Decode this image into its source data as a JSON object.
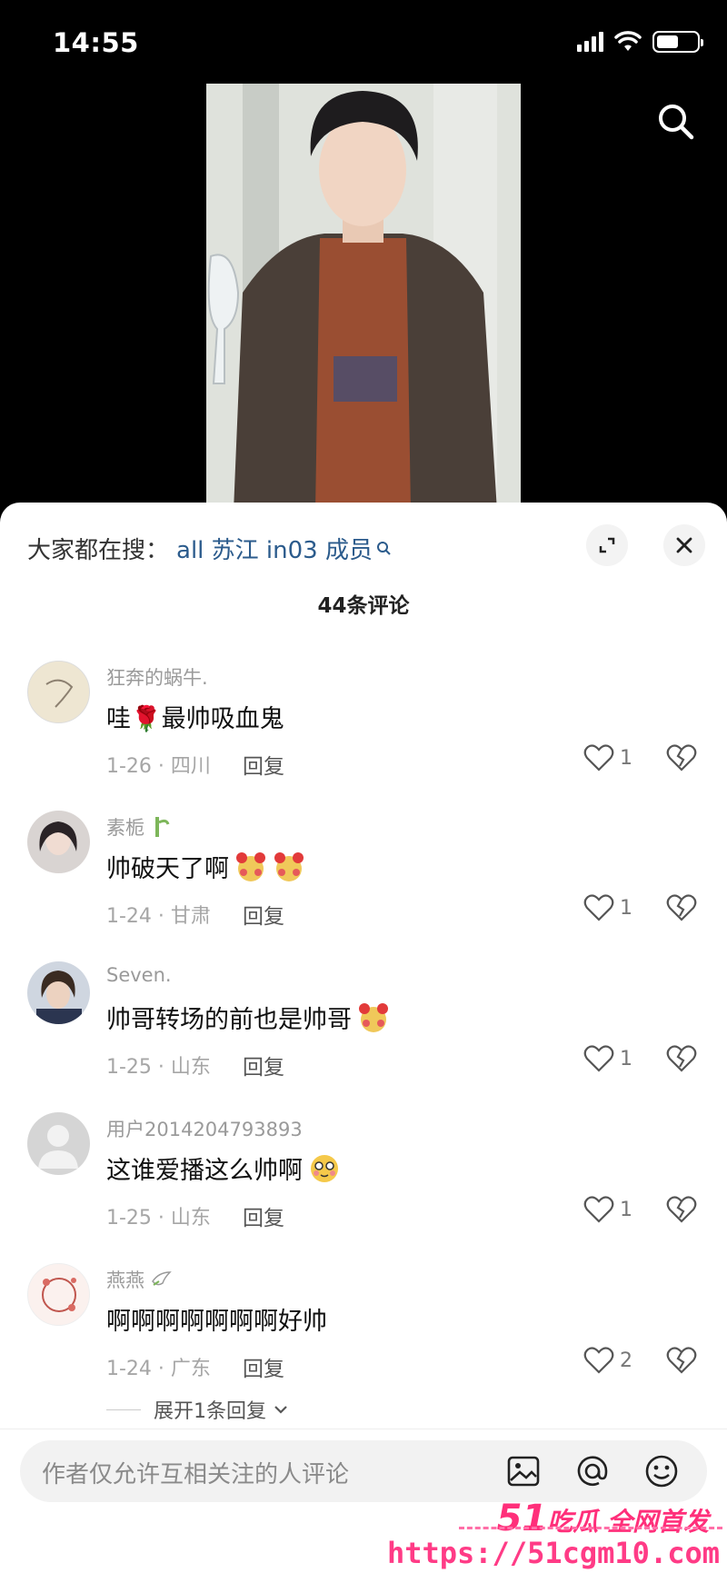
{
  "status_bar": {
    "time": "14:55",
    "battery_level": 0.55
  },
  "hot_search": {
    "label": "大家都在搜：",
    "query": "all 苏江 in03 成员"
  },
  "comment_count": "44条评论",
  "comments": [
    {
      "username": "狂奔的蜗牛.",
      "text": "哇🌹最帅吸血鬼",
      "date_location": "1-26 · 四川",
      "reply_label": "回复",
      "likes": "1"
    },
    {
      "username": "素栀",
      "text": "帅破天了啊",
      "date_location": "1-24 · 甘肃",
      "reply_label": "回复",
      "likes": "1"
    },
    {
      "username": "Seven.",
      "text": "帅哥转场的前也是帅哥",
      "date_location": "1-25 · 山东",
      "reply_label": "回复",
      "likes": "1"
    },
    {
      "username": "用户2014204793893",
      "text": "这谁爱播这么帅啊",
      "date_location": "1-25 · 山东",
      "reply_label": "回复",
      "likes": "1"
    },
    {
      "username": "燕燕",
      "text": "啊啊啊啊啊啊啊好帅",
      "date_location": "1-24 · 广东",
      "reply_label": "回复",
      "likes": "2"
    }
  ],
  "expand_replies": "展开1条回复",
  "input": {
    "placeholder": "作者仅允许互相关注的人评论"
  },
  "watermark": {
    "brand_num": "51",
    "brand_text": "吃瓜 全网首发",
    "url": "https://51cgm10.com"
  },
  "colors": {
    "accent_query": "#2b5b8c",
    "watermark": "#ff2f7a"
  }
}
